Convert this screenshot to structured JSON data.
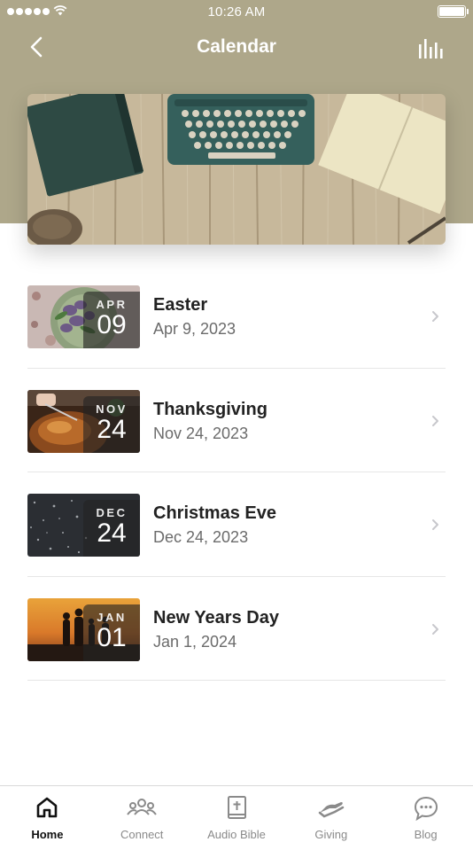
{
  "status_bar": {
    "time": "10:26 AM"
  },
  "nav": {
    "title": "Calendar"
  },
  "events": [
    {
      "title": "Easter",
      "date": "Apr 9, 2023",
      "month": "APR",
      "day": "09",
      "image": "purple-flowers-on-plate"
    },
    {
      "title": "Thanksgiving",
      "date": "Nov 24, 2023",
      "month": "NOV",
      "day": "24",
      "image": "roast-turkey"
    },
    {
      "title": "Christmas Eve",
      "date": "Dec 24, 2023",
      "month": "DEC",
      "day": "24",
      "image": "snowy-night"
    },
    {
      "title": "New Years Day",
      "date": "Jan 1, 2024",
      "month": "JAN",
      "day": "01",
      "image": "family-silhouette-sunset"
    }
  ],
  "tabs": [
    {
      "label": "Home",
      "icon": "home-icon",
      "active": true
    },
    {
      "label": "Connect",
      "icon": "people-icon",
      "active": false
    },
    {
      "label": "Audio Bible",
      "icon": "bible-icon",
      "active": false
    },
    {
      "label": "Giving",
      "icon": "giving-hand-icon",
      "active": false
    },
    {
      "label": "Blog",
      "icon": "chat-bubble-icon",
      "active": false
    }
  ],
  "colors": {
    "header": "#aea78a",
    "active_tab": "#111111",
    "inactive_tab": "#8a8a8a",
    "chevron": "#c7c7cc"
  }
}
